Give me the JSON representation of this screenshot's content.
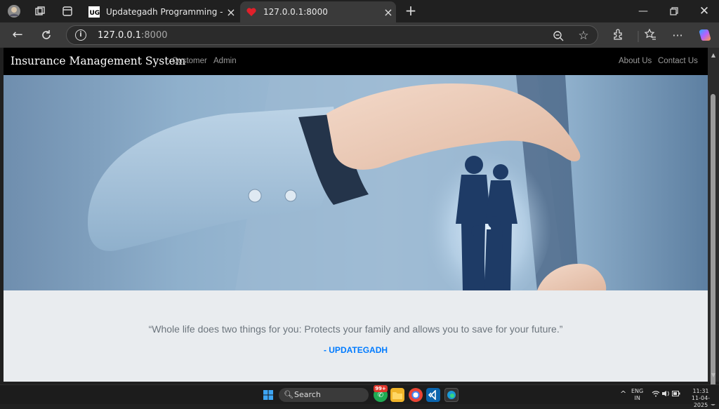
{
  "browser": {
    "tabs": [
      {
        "title": "Updategadh Programming - Upd",
        "active": false,
        "favicon": "ug-logo-icon"
      },
      {
        "title": "127.0.0.1:8000",
        "active": true,
        "favicon": "heart-icon"
      }
    ],
    "address": {
      "host": "127.0.0.1",
      "port": ":8000"
    }
  },
  "page": {
    "brand": "Insurance Management System",
    "nav_left": [
      "Customer",
      "Admin"
    ],
    "nav_right": [
      "About Us",
      "Contact Us"
    ],
    "quote": "“Whole life does two things for you: Protects your family and allows you to save for your future.”",
    "author": "- UPDATEGADH"
  },
  "taskbar": {
    "search_label": "Search",
    "badge_count": "99+",
    "lang_line1": "ENG",
    "lang_line2": "IN",
    "time": "11:31",
    "date": "11-04-2025"
  },
  "colors": {
    "accent": "#007bff",
    "navbar": "#000000",
    "quote_bg": "#e9ecef"
  }
}
